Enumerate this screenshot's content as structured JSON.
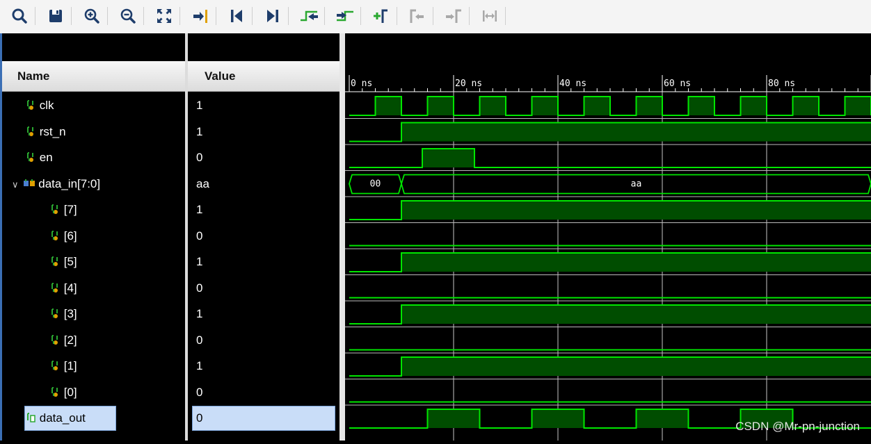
{
  "toolbar": {
    "icons": [
      "search-icon",
      "save-icon",
      "zoom-in-icon",
      "zoom-out-icon",
      "zoom-fit-icon",
      "go-to-cursor-icon",
      "go-to-time-zero-icon",
      "go-to-last-time-icon",
      "previous-transition-icon",
      "next-transition-icon",
      "add-marker-icon",
      "previous-marker-icon",
      "next-marker-icon",
      "swap-cursors-icon"
    ]
  },
  "columns": {
    "name": "Name",
    "value": "Value"
  },
  "signals": [
    {
      "name": "clk",
      "value": "1",
      "type": "bit"
    },
    {
      "name": "rst_n",
      "value": "1",
      "type": "bit"
    },
    {
      "name": "en",
      "value": "0",
      "type": "bit"
    },
    {
      "name": "data_in[7:0]",
      "value": "aa",
      "type": "bus",
      "expanded": true
    },
    {
      "name": "[7]",
      "value": "1",
      "type": "bit",
      "child": true
    },
    {
      "name": "[6]",
      "value": "0",
      "type": "bit",
      "child": true
    },
    {
      "name": "[5]",
      "value": "1",
      "type": "bit",
      "child": true
    },
    {
      "name": "[4]",
      "value": "0",
      "type": "bit",
      "child": true
    },
    {
      "name": "[3]",
      "value": "1",
      "type": "bit",
      "child": true
    },
    {
      "name": "[2]",
      "value": "0",
      "type": "bit",
      "child": true
    },
    {
      "name": "[1]",
      "value": "1",
      "type": "bit",
      "child": true
    },
    {
      "name": "[0]",
      "value": "0",
      "type": "bit",
      "child": true
    },
    {
      "name": "data_out",
      "value": "0",
      "type": "bit",
      "selected": true
    }
  ],
  "timeline": {
    "unit": "ns",
    "view_start_ns": 0,
    "view_end_ns": 100,
    "major_labels": [
      "0 ns",
      "20 ns",
      "40 ns",
      "60 ns",
      "80 ns"
    ]
  },
  "waveforms": {
    "clk": [
      [
        0,
        0
      ],
      [
        5,
        1
      ],
      [
        10,
        0
      ],
      [
        15,
        1
      ],
      [
        20,
        0
      ],
      [
        25,
        1
      ],
      [
        30,
        0
      ],
      [
        35,
        1
      ],
      [
        40,
        0
      ],
      [
        45,
        1
      ],
      [
        50,
        0
      ],
      [
        55,
        1
      ],
      [
        60,
        0
      ],
      [
        65,
        1
      ],
      [
        70,
        0
      ],
      [
        75,
        1
      ],
      [
        80,
        0
      ],
      [
        85,
        1
      ],
      [
        90,
        0
      ],
      [
        95,
        1
      ],
      [
        100,
        0
      ]
    ],
    "rst_n": [
      [
        0,
        0
      ],
      [
        10,
        1
      ]
    ],
    "en": [
      [
        0,
        0
      ],
      [
        14,
        1
      ],
      [
        24,
        0
      ]
    ],
    "data_in": [
      [
        "0",
        "00"
      ],
      [
        "10",
        "aa"
      ]
    ],
    "d7": [
      [
        0,
        0
      ],
      [
        10,
        1
      ]
    ],
    "d6": [
      [
        0,
        0
      ]
    ],
    "d5": [
      [
        0,
        0
      ],
      [
        10,
        1
      ]
    ],
    "d4": [
      [
        0,
        0
      ]
    ],
    "d3": [
      [
        0,
        0
      ],
      [
        10,
        1
      ]
    ],
    "d2": [
      [
        0,
        0
      ]
    ],
    "d1": [
      [
        0,
        0
      ],
      [
        10,
        1
      ]
    ],
    "d0": [
      [
        0,
        0
      ]
    ],
    "data_out": [
      [
        0,
        0
      ],
      [
        15,
        1
      ],
      [
        25,
        0
      ],
      [
        35,
        1
      ],
      [
        45,
        0
      ],
      [
        55,
        1
      ],
      [
        65,
        0
      ],
      [
        75,
        1
      ],
      [
        85,
        0
      ]
    ]
  },
  "colors": {
    "wave": "#00e600",
    "wave_fill": "#004d00",
    "grid": "#c8c8c8",
    "bus_text": "#ffffff",
    "icon_blue": "#1e3d6b",
    "icon_green": "#2aa830",
    "icon_gray": "#a8a8a8"
  },
  "watermark": "CSDN @Mr-pn-junction"
}
